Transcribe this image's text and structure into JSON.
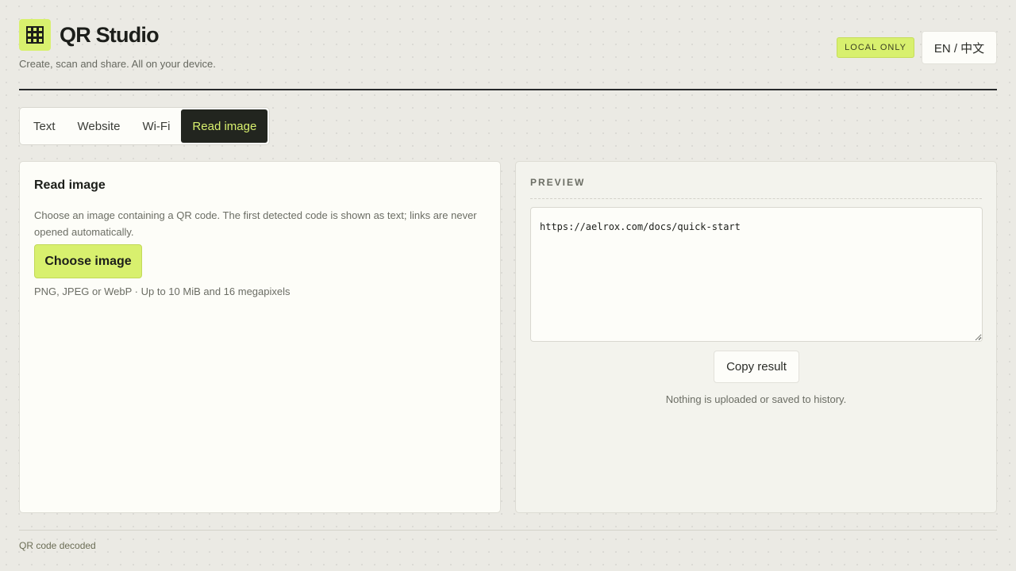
{
  "app": {
    "title": "QR Studio",
    "tagline": "Create, scan and share. All on your device.",
    "logo_icon": "qr-grid-icon",
    "local_badge": "LOCAL ONLY",
    "language_toggle": "EN / 中文"
  },
  "tabs": [
    {
      "label": "Text",
      "active": false
    },
    {
      "label": "Website",
      "active": false
    },
    {
      "label": "Wi-Fi",
      "active": false
    },
    {
      "label": "Read image",
      "active": true
    }
  ],
  "read_panel": {
    "title": "Read image",
    "description": "Choose an image containing a QR code. The first detected code is shown as text; links are never opened automatically.",
    "choose_button": "Choose image",
    "file_hint": "PNG, JPEG or WebP · Up to 10 MiB and 16 megapixels"
  },
  "preview": {
    "label": "PREVIEW",
    "result_value": "https://aelrox.com/docs/quick-start",
    "copy_button": "Copy result",
    "privacy_note": "Nothing is uploaded or saved to history."
  },
  "status": "QR code decoded",
  "colors": {
    "accent": "#d8f06e",
    "dark": "#22251f",
    "background": "#ebeae4"
  }
}
